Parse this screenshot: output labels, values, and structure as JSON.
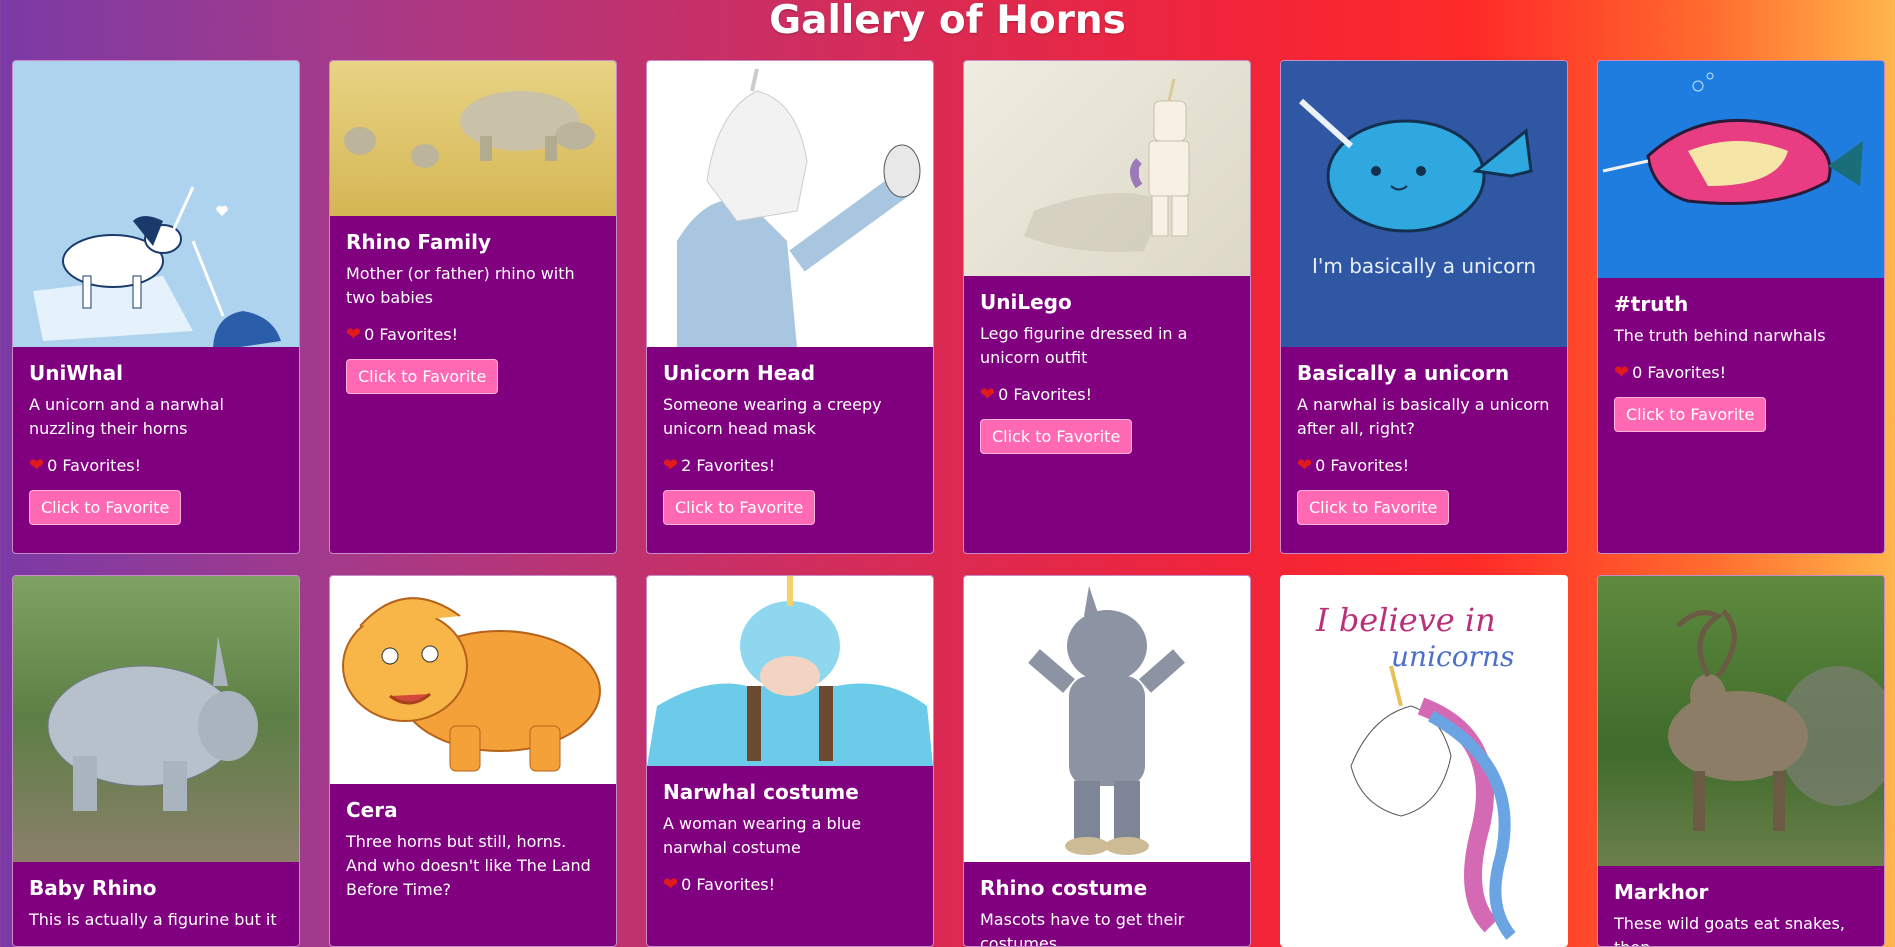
{
  "page": {
    "title": "Gallery of Horns"
  },
  "cards": [
    {
      "title": "UniWhal",
      "description": "A unicorn and a narwhal nuzzling their horns",
      "favorites": "0 Favorites!",
      "button": "Click to Favorite",
      "image_icon": "unicorn-narwhal-illustration"
    },
    {
      "title": "Rhino Family",
      "description": "Mother (or father) rhino with two babies",
      "favorites": "0 Favorites!",
      "button": "Click to Favorite",
      "image_icon": "rhino-family-photo"
    },
    {
      "title": "Unicorn Head",
      "description": "Someone wearing a creepy unicorn head mask",
      "favorites": "2 Favorites!",
      "button": "Click to Favorite",
      "image_icon": "unicorn-mask-photo"
    },
    {
      "title": "UniLego",
      "description": "Lego figurine dressed in a unicorn outfit",
      "favorites": "0 Favorites!",
      "button": "Click to Favorite",
      "image_icon": "lego-unicorn-photo"
    },
    {
      "title": "Basically a unicorn",
      "description": "A narwhal is basically a unicorn after all, right?",
      "favorites": "0 Favorites!",
      "button": "Click to Favorite",
      "image_icon": "narwhal-illustration",
      "image_caption": "I'm basically a unicorn"
    },
    {
      "title": "#truth",
      "description": "The truth behind narwhals",
      "favorites": "0 Favorites!",
      "button": "Click to Favorite",
      "image_icon": "narwhal-truth-drawing"
    },
    {
      "title": "Baby Rhino",
      "description": "This is actually a figurine but it",
      "image_icon": "baby-rhino-figurine-photo"
    },
    {
      "title": "Cera",
      "description": "Three horns but still, horns. And who doesn't like The Land Before Time?",
      "image_icon": "cera-dinosaur-illustration"
    },
    {
      "title": "Narwhal costume",
      "description": "A woman wearing a blue narwhal costume",
      "favorites": "0 Favorites!",
      "image_icon": "narwhal-costume-photo"
    },
    {
      "title": "Rhino costume",
      "description": "Mascots have to get their costumes",
      "image_icon": "rhino-mascot-photo"
    },
    {
      "title": "",
      "description": "",
      "image_icon": "believe-in-unicorns-art",
      "image_caption_1": "I believe in",
      "image_caption_2": "unicorns"
    },
    {
      "title": "Markhor",
      "description": "These wild goats eat snakes, then",
      "image_icon": "markhor-goat-photo"
    }
  ]
}
